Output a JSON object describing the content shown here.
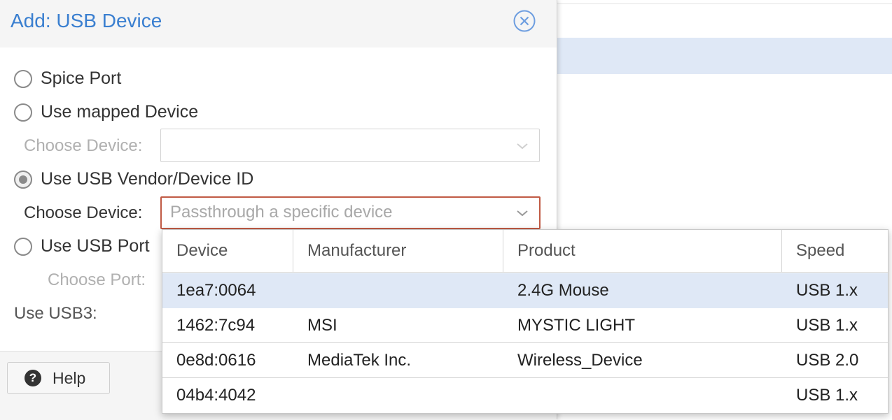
{
  "dialog": {
    "title": "Add: USB Device",
    "close_icon": "close-circle-icon"
  },
  "options": {
    "spice_port": "Spice Port",
    "mapped_device": "Use mapped Device",
    "mapped_choose_label": "Choose Device:",
    "vendor_id": "Use USB Vendor/Device ID",
    "vendor_choose_label": "Choose Device:",
    "vendor_placeholder": "Passthrough a specific device",
    "usb_port": "Use USB Port",
    "port_choose_label": "Choose Port:",
    "usb3_label": "Use USB3:",
    "selected": "vendor_id"
  },
  "footer": {
    "help_label": "Help",
    "help_icon": "question-circle-icon"
  },
  "device_grid": {
    "columns": [
      "Device",
      "Manufacturer",
      "Product",
      "Speed"
    ],
    "rows": [
      {
        "device": "1ea7:0064",
        "manufacturer": "",
        "product": "2.4G Mouse",
        "speed": "USB 1.x",
        "selected": true
      },
      {
        "device": "1462:7c94",
        "manufacturer": "MSI",
        "product": "MYSTIC LIGHT",
        "speed": "USB 1.x",
        "selected": false
      },
      {
        "device": "0e8d:0616",
        "manufacturer": "MediaTek Inc.",
        "product": "Wireless_Device",
        "speed": "USB 2.0",
        "selected": false
      },
      {
        "device": "04b4:4042",
        "manufacturer": "",
        "product": "",
        "speed": "USB 1.x",
        "selected": false
      }
    ]
  },
  "colors": {
    "title_blue": "#3a7fd0",
    "active_border": "#c05a44",
    "selected_row": "#dfe8f6"
  }
}
